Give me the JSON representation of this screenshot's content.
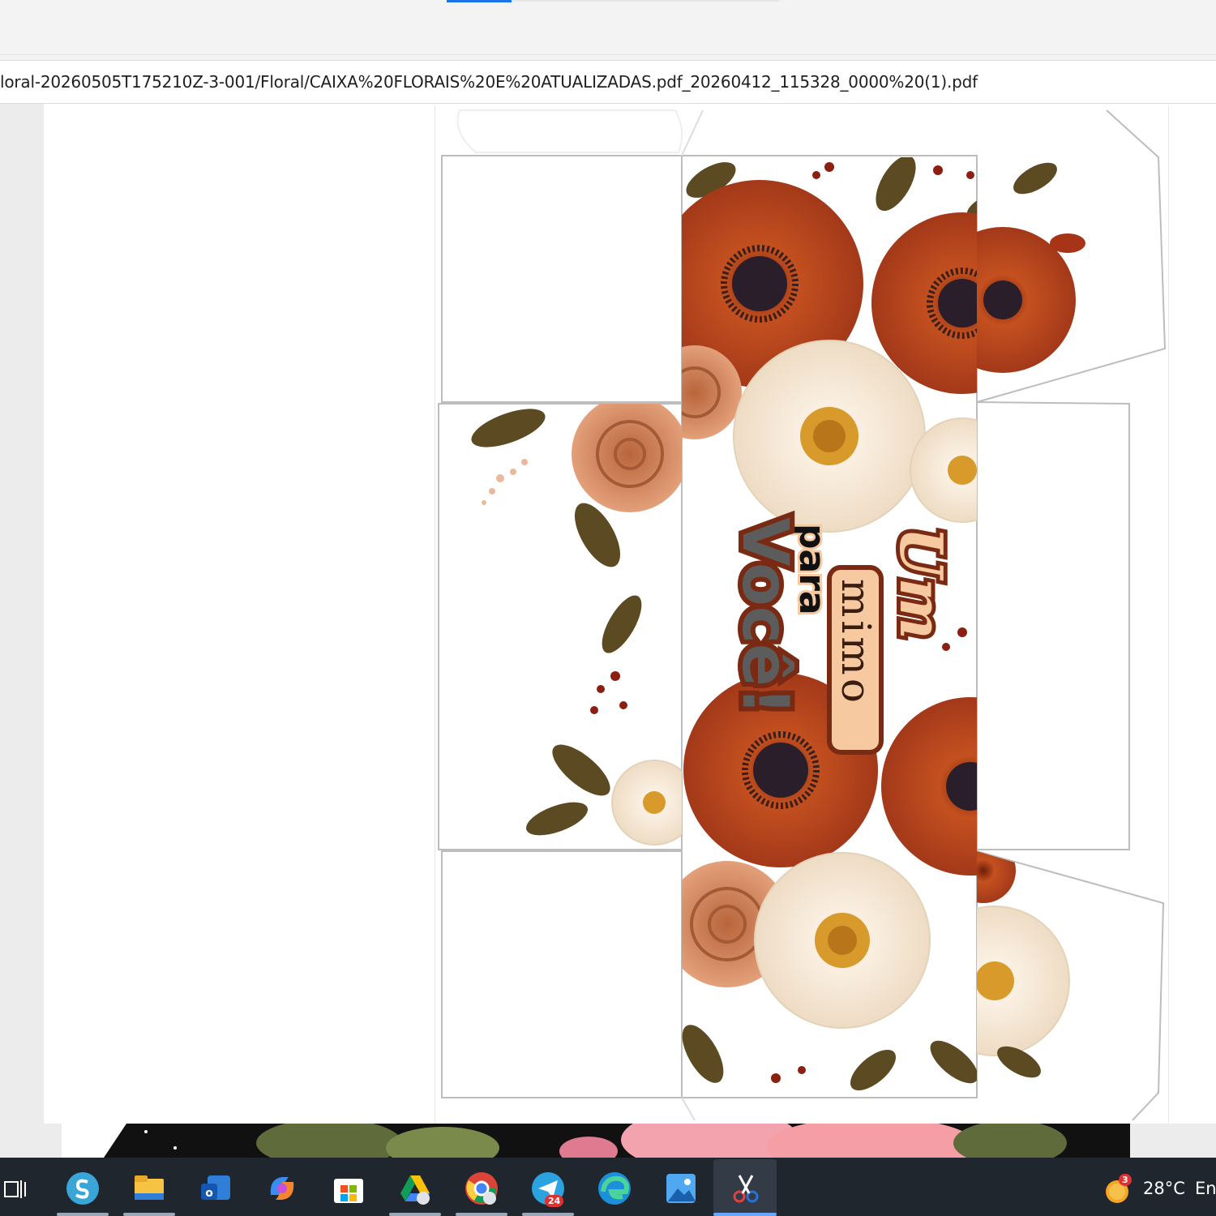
{
  "browser": {
    "url": "loral-20260505T175210Z-3-001/Floral/CAIXA%20FLORAIS%20E%20ATUALIZADAS.pdf_20260412_115328_0000%20(1).pdf"
  },
  "document": {
    "text_line1": "Um",
    "text_line2": "mimo",
    "text_line3": "para",
    "text_line4": "Você!",
    "colors": {
      "red_petal": "#b8421c",
      "dark_petal": "#8a2a10",
      "peach_rose": "#d98a5e",
      "daisy": "#fbf3e6",
      "leaf": "#5c4a22",
      "text_outline": "#7a2a12",
      "text_fill": "#f6c9a0"
    }
  },
  "taskbar": {
    "items": [
      {
        "name": "task-view-icon"
      },
      {
        "name": "s-app-icon"
      },
      {
        "name": "file-explorer-icon"
      },
      {
        "name": "outlook-icon"
      },
      {
        "name": "copilot-icon"
      },
      {
        "name": "store-icon"
      },
      {
        "name": "google-drive-icon"
      },
      {
        "name": "chrome-icon"
      },
      {
        "name": "telegram-icon",
        "badge": "24"
      },
      {
        "name": "edge-icon"
      },
      {
        "name": "photos-icon"
      },
      {
        "name": "snipping-tool-icon"
      }
    ],
    "weather_badge": "3",
    "temperature": "28°C",
    "language": "En"
  }
}
